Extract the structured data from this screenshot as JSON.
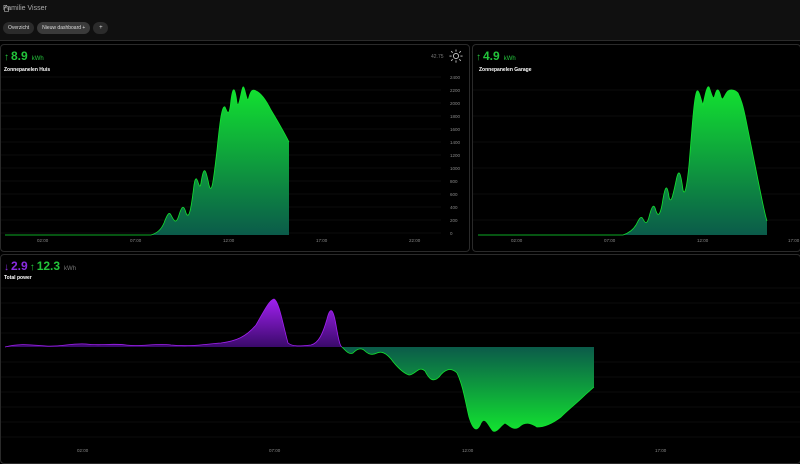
{
  "app": {
    "title": "Familie Visser"
  },
  "tabs": [
    {
      "label": "Overzicht"
    },
    {
      "label": "Nieuw dashboard +"
    },
    {
      "label": "+"
    }
  ],
  "cards": {
    "house": {
      "value": "8.9",
      "unit": "kWh",
      "label": "Zonnepanelen Huis",
      "aux_value": "42.75",
      "y_ticks": [
        "2400",
        "2200",
        "2000",
        "1800",
        "1600",
        "1400",
        "1200",
        "1000",
        "800",
        "600",
        "400",
        "200",
        "0"
      ],
      "x_ticks": [
        "02:00",
        "07:00",
        "12:00",
        "17:00",
        "22:00"
      ]
    },
    "garage": {
      "value": "4.9",
      "unit": "kWh",
      "label": "Zonnepanelen Garage",
      "x_ticks": [
        "02:00",
        "07:00",
        "12:00",
        "17:00"
      ]
    },
    "total": {
      "value_down": "2.9",
      "value_up": "12.3",
      "unit": "kWh",
      "label": "Total power",
      "x_ticks": [
        "02:00",
        "07:00",
        "12:00",
        "17:00"
      ]
    }
  },
  "colors": {
    "green": "#23c43b",
    "purple": "#8a2be2",
    "dark_green": "#0b5b4a"
  },
  "icons": {
    "home": "home-icon",
    "sun": "sun-icon"
  }
}
